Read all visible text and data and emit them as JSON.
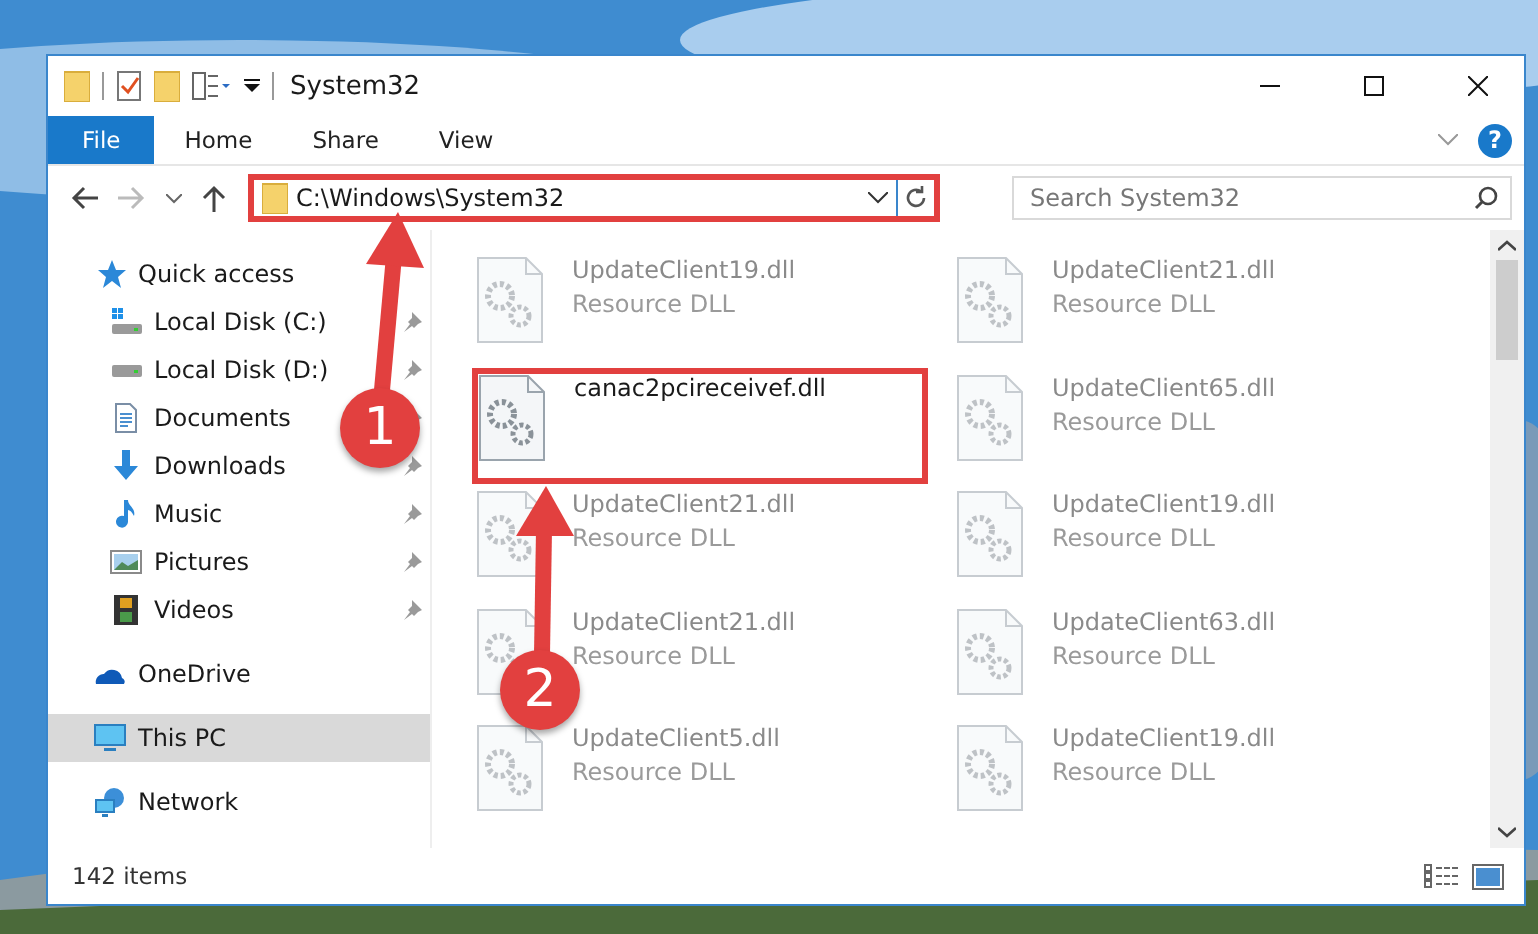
{
  "window": {
    "title": "System32"
  },
  "ribbon": {
    "tabs": [
      {
        "label": "File",
        "selected": true
      },
      {
        "label": "Home",
        "selected": false
      },
      {
        "label": "Share",
        "selected": false
      },
      {
        "label": "View",
        "selected": false
      }
    ],
    "help_button": "?"
  },
  "address_bar": {
    "path": "C:\\Windows\\System32",
    "highlighted": true
  },
  "search": {
    "placeholder": "Search System32"
  },
  "navigation": [
    {
      "label": "Quick access",
      "kind": "quick",
      "selected": false,
      "children": [
        {
          "label": "Local Disk (C:)",
          "kind": "system-drive",
          "pinned": true,
          "selected": false
        },
        {
          "label": "Local Disk (D:)",
          "kind": "drive",
          "pinned": true,
          "selected": false
        },
        {
          "label": "Documents",
          "kind": "documents",
          "pinned": true,
          "selected": false
        },
        {
          "label": "Downloads",
          "kind": "downloads",
          "pinned": true,
          "selected": false
        },
        {
          "label": "Music",
          "kind": "music",
          "pinned": true,
          "selected": false
        },
        {
          "label": "Pictures",
          "kind": "pictures",
          "pinned": true,
          "selected": false
        },
        {
          "label": "Videos",
          "kind": "videos",
          "pinned": true,
          "selected": false
        }
      ]
    },
    {
      "label": "OneDrive",
      "kind": "cloud",
      "selected": false
    },
    {
      "label": "This PC",
      "kind": "pc",
      "selected": true
    },
    {
      "label": "Network",
      "kind": "network",
      "selected": false
    }
  ],
  "files": [
    {
      "name": "UpdateClient19.dll",
      "type": "Resource DLL",
      "dimmed": true,
      "highlighted": false
    },
    {
      "name": "UpdateClient21.dll",
      "type": "Resource DLL",
      "dimmed": true,
      "highlighted": false
    },
    {
      "name": "canac2pcireceivef.dll",
      "dimmed": false,
      "highlighted": true
    },
    {
      "name": "UpdateClient65.dll",
      "type": "Resource DLL",
      "dimmed": true,
      "highlighted": false
    },
    {
      "name": "UpdateClient21.dll",
      "type": "Resource DLL",
      "dimmed": true,
      "highlighted": false
    },
    {
      "name": "UpdateClient19.dll",
      "type": "Resource DLL",
      "dimmed": true,
      "highlighted": false
    },
    {
      "name": "UpdateClient21.dll",
      "type": "Resource DLL",
      "dimmed": true,
      "highlighted": false
    },
    {
      "name": "UpdateClient63.dll",
      "type": "Resource DLL",
      "dimmed": true,
      "highlighted": false
    },
    {
      "name": "UpdateClient5.dll",
      "type": "Resource DLL",
      "dimmed": true,
      "highlighted": false
    },
    {
      "name": "UpdateClient19.dll",
      "type": "Resource DLL",
      "dimmed": true,
      "highlighted": false
    }
  ],
  "status_bar": {
    "item_count": "142 items"
  },
  "callouts": [
    {
      "number": "1"
    },
    {
      "number": "2"
    }
  ]
}
